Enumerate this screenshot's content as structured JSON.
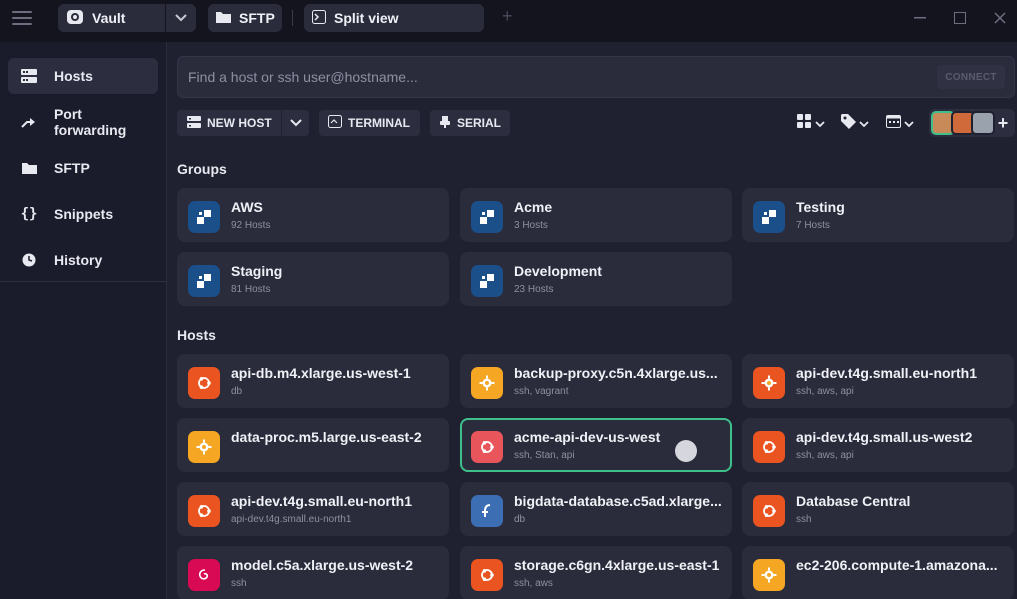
{
  "titlebar": {
    "tabs": [
      {
        "label": "Vault"
      },
      {
        "label": "SFTP"
      },
      {
        "label": "Split view"
      }
    ],
    "new_tab_symbol": "+"
  },
  "sidebar": {
    "items": [
      {
        "label": "Hosts",
        "icon": "hosts-icon",
        "active": true
      },
      {
        "label": "Port forwarding",
        "icon": "port-forwarding-icon"
      },
      {
        "label": "SFTP",
        "icon": "folder-icon"
      },
      {
        "label": "Snippets",
        "icon": "braces-icon"
      },
      {
        "label": "History",
        "icon": "clock-icon"
      }
    ]
  },
  "search": {
    "placeholder": "Find a host or ssh user@hostname...",
    "value": "",
    "connect_label": "CONNECT"
  },
  "toolbar": {
    "new_host_label": "NEW HOST",
    "terminal_label": "TERMINAL",
    "serial_label": "SERIAL",
    "add_member_symbol": "+"
  },
  "groups_title": "Groups",
  "groups": [
    {
      "name": "AWS",
      "count": "92 Hosts"
    },
    {
      "name": "Acme",
      "count": "3 Hosts"
    },
    {
      "name": "Testing",
      "count": "7 Hosts"
    },
    {
      "name": "Staging",
      "count": "81 Hosts"
    },
    {
      "name": "Development",
      "count": "23 Hosts"
    }
  ],
  "hosts_title": "Hosts",
  "hosts": [
    {
      "name": "api-db.m4.xlarge.us-west-1",
      "tags": "db",
      "os": "ubuntu",
      "color": "#e95420"
    },
    {
      "name": "backup-proxy.c5n.4xlarge.us...",
      "tags": "ssh, vagrant",
      "os": "gear",
      "color": "#f5a623"
    },
    {
      "name": "api-dev.t4g.small.eu-north1",
      "tags": "ssh, aws, api",
      "os": "gear",
      "color": "#e95420"
    },
    {
      "name": "data-proc.m5.large.us-east-2",
      "tags": "",
      "os": "gear",
      "color": "#f5a623"
    },
    {
      "name": "acme-api-dev-us-west",
      "tags": "ssh, Stan, api",
      "os": "ubuntu",
      "color": "#e8555a",
      "selected": true
    },
    {
      "name": "api-dev.t4g.small.us-west2",
      "tags": "ssh, aws, api",
      "os": "ubuntu",
      "color": "#e95420"
    },
    {
      "name": "api-dev.t4g.small.eu-north1",
      "tags": "api-dev.t4g.small.eu-north1",
      "os": "ubuntu",
      "color": "#e95420"
    },
    {
      "name": "bigdata-database.c5ad.xlarge...",
      "tags": "db",
      "os": "fedora",
      "color": "#3c6eb4"
    },
    {
      "name": "Database Central",
      "tags": "ssh",
      "os": "ubuntu",
      "color": "#e95420"
    },
    {
      "name": "model.c5a.xlarge.us-west-2",
      "tags": "ssh",
      "os": "debian",
      "color": "#d70a53"
    },
    {
      "name": "storage.c6gn.4xlarge.us-east-1",
      "tags": "ssh, aws",
      "os": "ubuntu",
      "color": "#e95420"
    },
    {
      "name": "ec2-206.compute-1.amazona...",
      "tags": "",
      "os": "gear",
      "color": "#f5a623"
    }
  ],
  "colors": {
    "accent_selected": "#3fbf8a",
    "group_badge": "#1b4f8a"
  }
}
